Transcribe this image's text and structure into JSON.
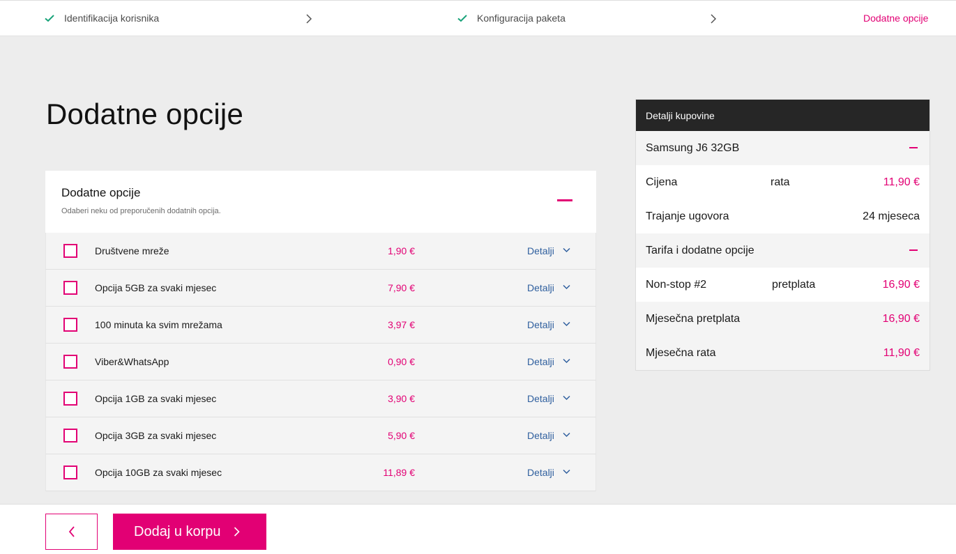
{
  "stepper": {
    "steps": [
      {
        "label": "Identifikacija korisnika",
        "state": "done"
      },
      {
        "label": "Konfiguracija paketa",
        "state": "done"
      },
      {
        "label": "Dodatne opcije",
        "state": "active"
      }
    ]
  },
  "page": {
    "title": "Dodatne opcije"
  },
  "options": {
    "title": "Dodatne opcije",
    "subtitle": "Odaberi neku od preporučenih dodatnih opcija.",
    "details_label": "Detalji",
    "items": [
      {
        "name": "Društvene mreže",
        "price": "1,90 €",
        "checked": false
      },
      {
        "name": "Opcija 5GB za svaki mjesec",
        "price": "7,90 €",
        "checked": false
      },
      {
        "name": "100 minuta ka svim mrežama",
        "price": "3,97 €",
        "checked": false
      },
      {
        "name": "Viber&WhatsApp",
        "price": "0,90 €",
        "checked": false
      },
      {
        "name": "Opcija 1GB za svaki mjesec",
        "price": "3,90 €",
        "checked": false
      },
      {
        "name": "Opcija 3GB za svaki mjesec",
        "price": "5,90 €",
        "checked": false
      },
      {
        "name": "Opcija 10GB za svaki mjesec",
        "price": "11,89 €",
        "checked": false
      }
    ]
  },
  "summary": {
    "title": "Detalji kupovine",
    "device": {
      "name": "Samsung J6 32GB",
      "price_label": "Cijena",
      "price_type": "rata",
      "price_value": "11,90 €",
      "contract_label": "Trajanje ugovora",
      "contract_value": "24 mjeseca"
    },
    "tariff": {
      "section_label": "Tarifa i dodatne opcije",
      "name": "Non-stop #2",
      "type": "pretplata",
      "value": "16,90 €"
    },
    "monthly_subscription_label": "Mjesečna pretplata",
    "monthly_subscription_value": "16,90 €",
    "monthly_installment_label": "Mjesečna rata",
    "monthly_installment_value": "11,90 €"
  },
  "footer": {
    "add_to_cart_label": "Dodaj u korpu"
  },
  "colors": {
    "accent": "#e20074",
    "link": "#2f5f9e",
    "header_dark": "#262626"
  }
}
